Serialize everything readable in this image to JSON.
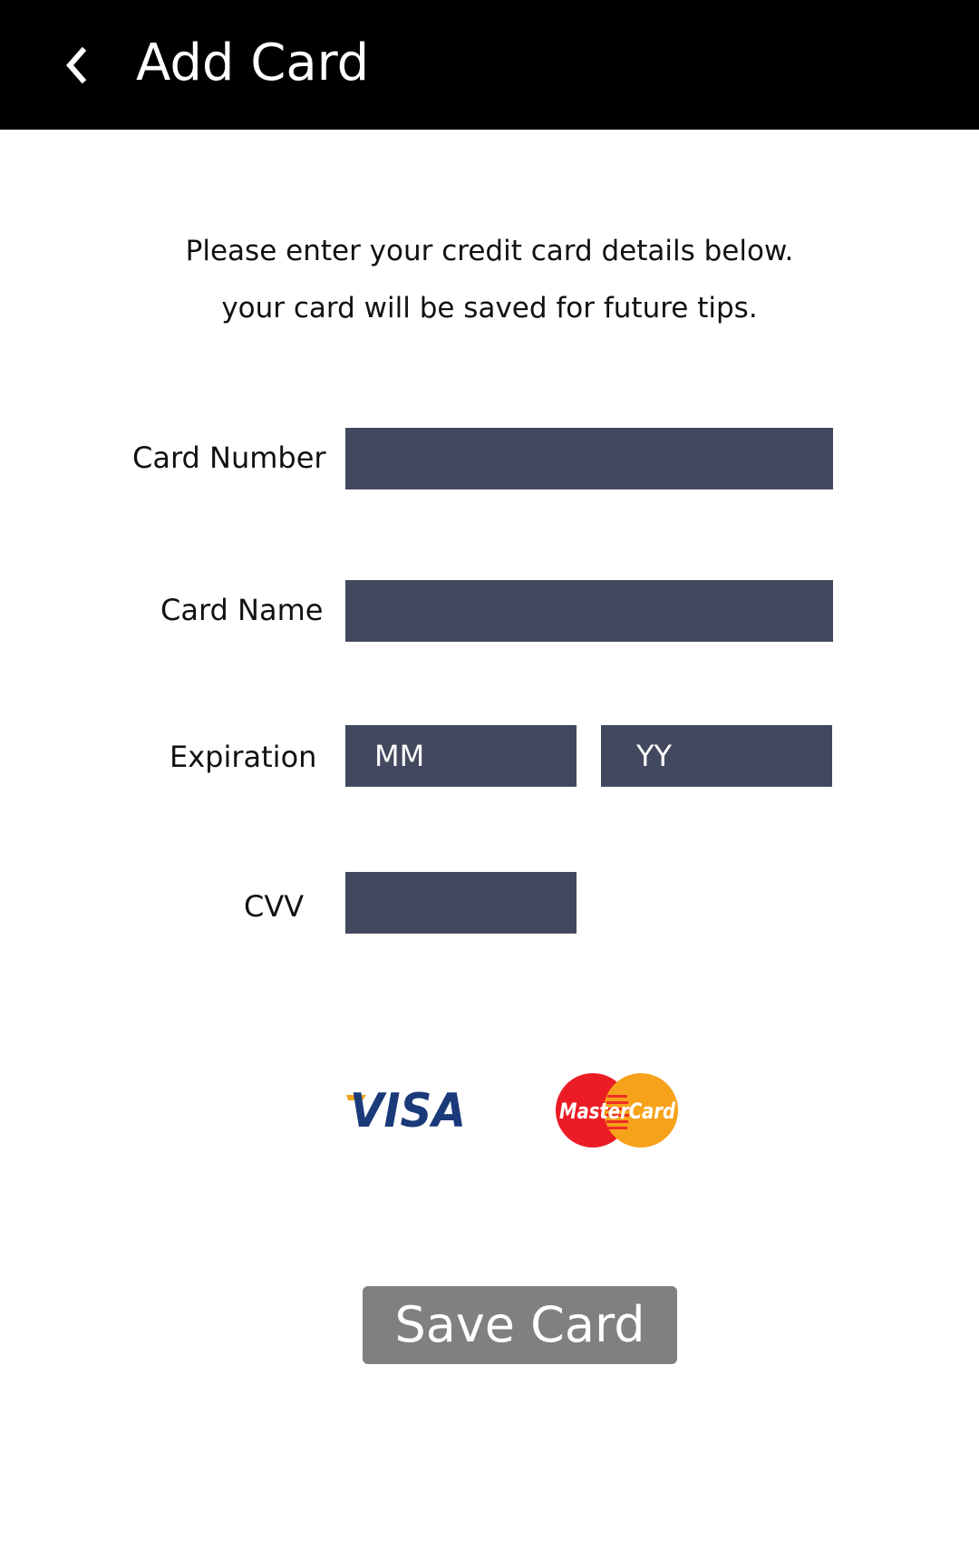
{
  "header": {
    "title": "Add Card",
    "back_icon": "chevron-left-icon"
  },
  "intro": {
    "line1": "Please enter your credit card details below.",
    "line2": "your card will be saved for future tips."
  },
  "form": {
    "card_number": {
      "label": "Card Number",
      "value": "",
      "placeholder": ""
    },
    "card_name": {
      "label": "Card Name",
      "value": "",
      "placeholder": ""
    },
    "expiration": {
      "label": "Expiration",
      "month_placeholder": "MM",
      "year_placeholder": "YY"
    },
    "cvv": {
      "label": "CVV",
      "value": "",
      "placeholder": ""
    }
  },
  "accepted_cards": {
    "visa": "VISA",
    "mastercard": "MasterCard"
  },
  "actions": {
    "save_label": "Save Card"
  },
  "colors": {
    "appbar": "#000000",
    "field_bg": "#42485e",
    "button_bg": "#808080",
    "visa_blue": "#1a3a7a",
    "visa_gold": "#f2a31b",
    "mc_red": "#eb1c26",
    "mc_yellow": "#f7a21b"
  }
}
